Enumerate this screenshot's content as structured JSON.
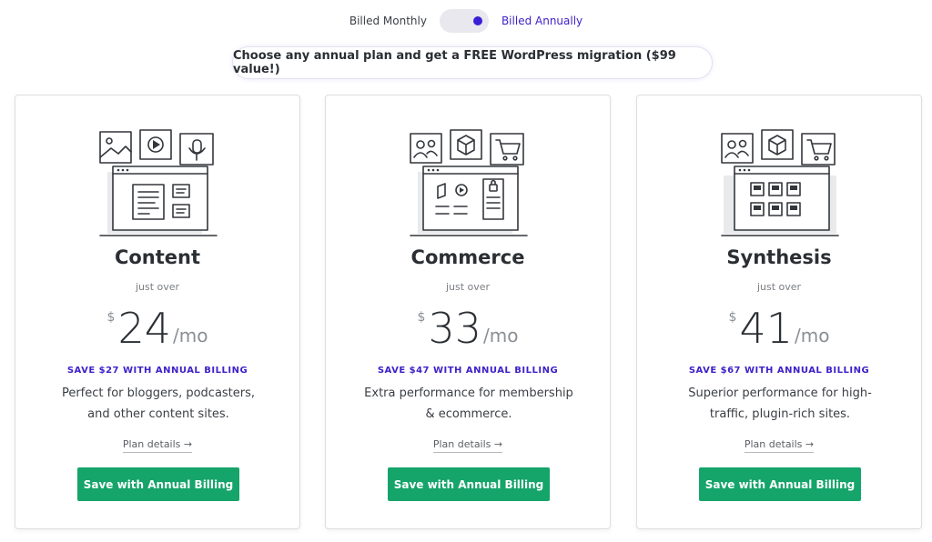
{
  "billing": {
    "monthly_label": "Billed Monthly",
    "annual_label": "Billed Annually",
    "selected": "annual"
  },
  "promo": "Choose any annual plan and get a FREE WordPress migration ($99 value!)",
  "plans": [
    {
      "name": "Content",
      "just_over": "just over",
      "currency": "$",
      "amount": "24",
      "per": "/mo",
      "save": "SAVE $27 WITH ANNUAL BILLING",
      "description": "Perfect for bloggers, podcasters, and other content sites.",
      "details": "Plan details →",
      "cta": "Save with Annual Billing",
      "icons": [
        "image-icon",
        "play-icon",
        "microphone-icon"
      ]
    },
    {
      "name": "Commerce",
      "just_over": "just over",
      "currency": "$",
      "amount": "33",
      "per": "/mo",
      "save": "SAVE $47 WITH ANNUAL BILLING",
      "description": "Extra performance for membership & ecommerce.",
      "details": "Plan details →",
      "cta": "Save with Annual Billing",
      "icons": [
        "users-icon",
        "box-icon",
        "cart-icon"
      ]
    },
    {
      "name": "Synthesis",
      "just_over": "just over",
      "currency": "$",
      "amount": "41",
      "per": "/mo",
      "save": "SAVE $67 WITH ANNUAL BILLING",
      "description": "Superior performance for high-traffic, plugin-rich sites.",
      "details": "Plan details →",
      "cta": "Save with Annual Billing",
      "icons": [
        "users-icon",
        "box-icon",
        "cart-icon"
      ]
    }
  ],
  "colors": {
    "accent_purple": "#3f21c9",
    "cta_green": "#15a46a"
  }
}
